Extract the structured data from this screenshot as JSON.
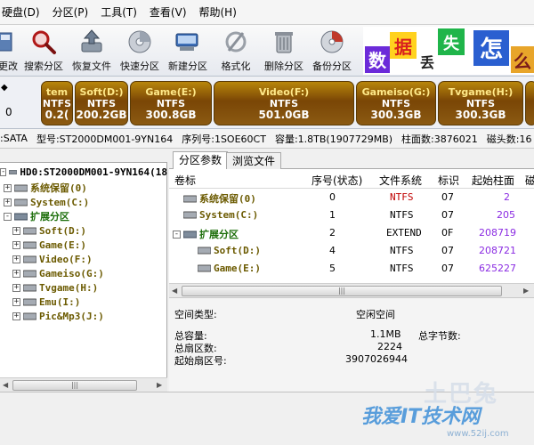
{
  "menu": [
    "硬盘(D)",
    "分区(P)",
    "工具(T)",
    "查看(V)",
    "帮助(H)"
  ],
  "toolbar": {
    "buttons": [
      {
        "label": "更改",
        "icon": "save-changes-icon"
      },
      {
        "label": "搜索分区",
        "icon": "search-icon"
      },
      {
        "label": "恢复文件",
        "icon": "recover-files-icon"
      },
      {
        "label": "快速分区",
        "icon": "quick-partition-icon"
      },
      {
        "label": "新建分区",
        "icon": "new-partition-icon"
      },
      {
        "label": "格式化",
        "icon": "format-icon"
      },
      {
        "label": "删除分区",
        "icon": "delete-icon"
      },
      {
        "label": "备份分区",
        "icon": "backup-icon"
      }
    ],
    "banner": {
      "chars": [
        "数",
        "据",
        "丢",
        "失",
        "怎",
        "么"
      ]
    }
  },
  "diskbar": {
    "nav_label": "0",
    "partitions": [
      {
        "name": "tem",
        "fs": "NTFS",
        "size": "0.2(",
        "truncated": true
      },
      {
        "name": "Soft(D:)",
        "fs": "NTFS",
        "size": "200.2GB"
      },
      {
        "name": "Game(E:)",
        "fs": "NTFS",
        "size": "300.8GB"
      },
      {
        "name": "Video(F:)",
        "fs": "NTFS",
        "size": "501.0GB"
      },
      {
        "name": "Gameiso(G:)",
        "fs": "NTFS",
        "size": "300.3GB"
      },
      {
        "name": "Tvgame(H:)",
        "fs": "NTFS",
        "size": "300.3GB"
      }
    ]
  },
  "info": {
    "interface": ":SATA",
    "model": "型号:ST2000DM001-9YN164",
    "serial": "序列号:1SOE60CT",
    "capacity": "容量:1.8TB(1907729MB)",
    "cylinders": "柱面数:3876021",
    "heads": "磁头数:16"
  },
  "tree": {
    "root": "HD0:ST2000DM001-9YN164(18",
    "items": [
      {
        "label": "系统保留(0)",
        "color": "olive",
        "expander": "+"
      },
      {
        "label": "System(C:)",
        "color": "olive",
        "expander": "+"
      },
      {
        "label": "扩展分区",
        "color": "green",
        "expander": "-"
      },
      {
        "label": "Soft(D:)",
        "color": "olive",
        "expander": "+"
      },
      {
        "label": "Game(E:)",
        "color": "olive",
        "expander": "+"
      },
      {
        "label": "Video(F:)",
        "color": "olive",
        "expander": "+"
      },
      {
        "label": "Gameiso(G:)",
        "color": "olive",
        "expander": "+"
      },
      {
        "label": "Tvgame(H:)",
        "color": "olive",
        "expander": "+"
      },
      {
        "label": "Emu(I:)",
        "color": "olive",
        "expander": "+"
      },
      {
        "label": "Pic&Mp3(J:)",
        "color": "olive",
        "expander": "+"
      }
    ]
  },
  "tabs": [
    "分区参数",
    "浏览文件"
  ],
  "table": {
    "headers": [
      "卷标",
      "序号(状态)",
      "文件系统",
      "标识",
      "起始柱面",
      "磁"
    ],
    "rows": [
      {
        "name": "系统保留(0)",
        "index": "0",
        "fs": "NTFS",
        "fs_color": "#c00000",
        "id": "07",
        "cyl": "2"
      },
      {
        "name": "System(C:)",
        "index": "1",
        "fs": "NTFS",
        "fs_color": "#000000",
        "id": "07",
        "cyl": "205"
      },
      {
        "name": "扩展分区",
        "index": "2",
        "fs": "EXTEND",
        "fs_color": "#000000",
        "id": "0F",
        "cyl": "208719"
      },
      {
        "name": "Soft(D:)",
        "index": "4",
        "fs": "NTFS",
        "fs_color": "#000000",
        "id": "07",
        "cyl": "208721"
      },
      {
        "name": "Game(E:)",
        "index": "5",
        "fs": "NTFS",
        "fs_color": "#000000",
        "id": "07",
        "cyl": "625227"
      }
    ]
  },
  "details": {
    "space_type_label": "空间类型:",
    "space_type_value": "空闲空间",
    "total_capacity_label": "总容量:",
    "total_capacity_value": "1.1MB",
    "total_bytes_label": "总字节数:",
    "total_sectors_label": "总扇区数:",
    "total_sectors_value": "2224",
    "start_sector_label": "起始扇区号:",
    "start_sector_value": "3907026944"
  },
  "watermark": {
    "line1": "土巴兔",
    "line2": "我爱IT技术网",
    "line3": "www.52ij.com"
  },
  "colors": {
    "partition_fill": "#7a4606",
    "partition_name": "#ffe98a",
    "cylinder_text": "#8a2be2"
  }
}
